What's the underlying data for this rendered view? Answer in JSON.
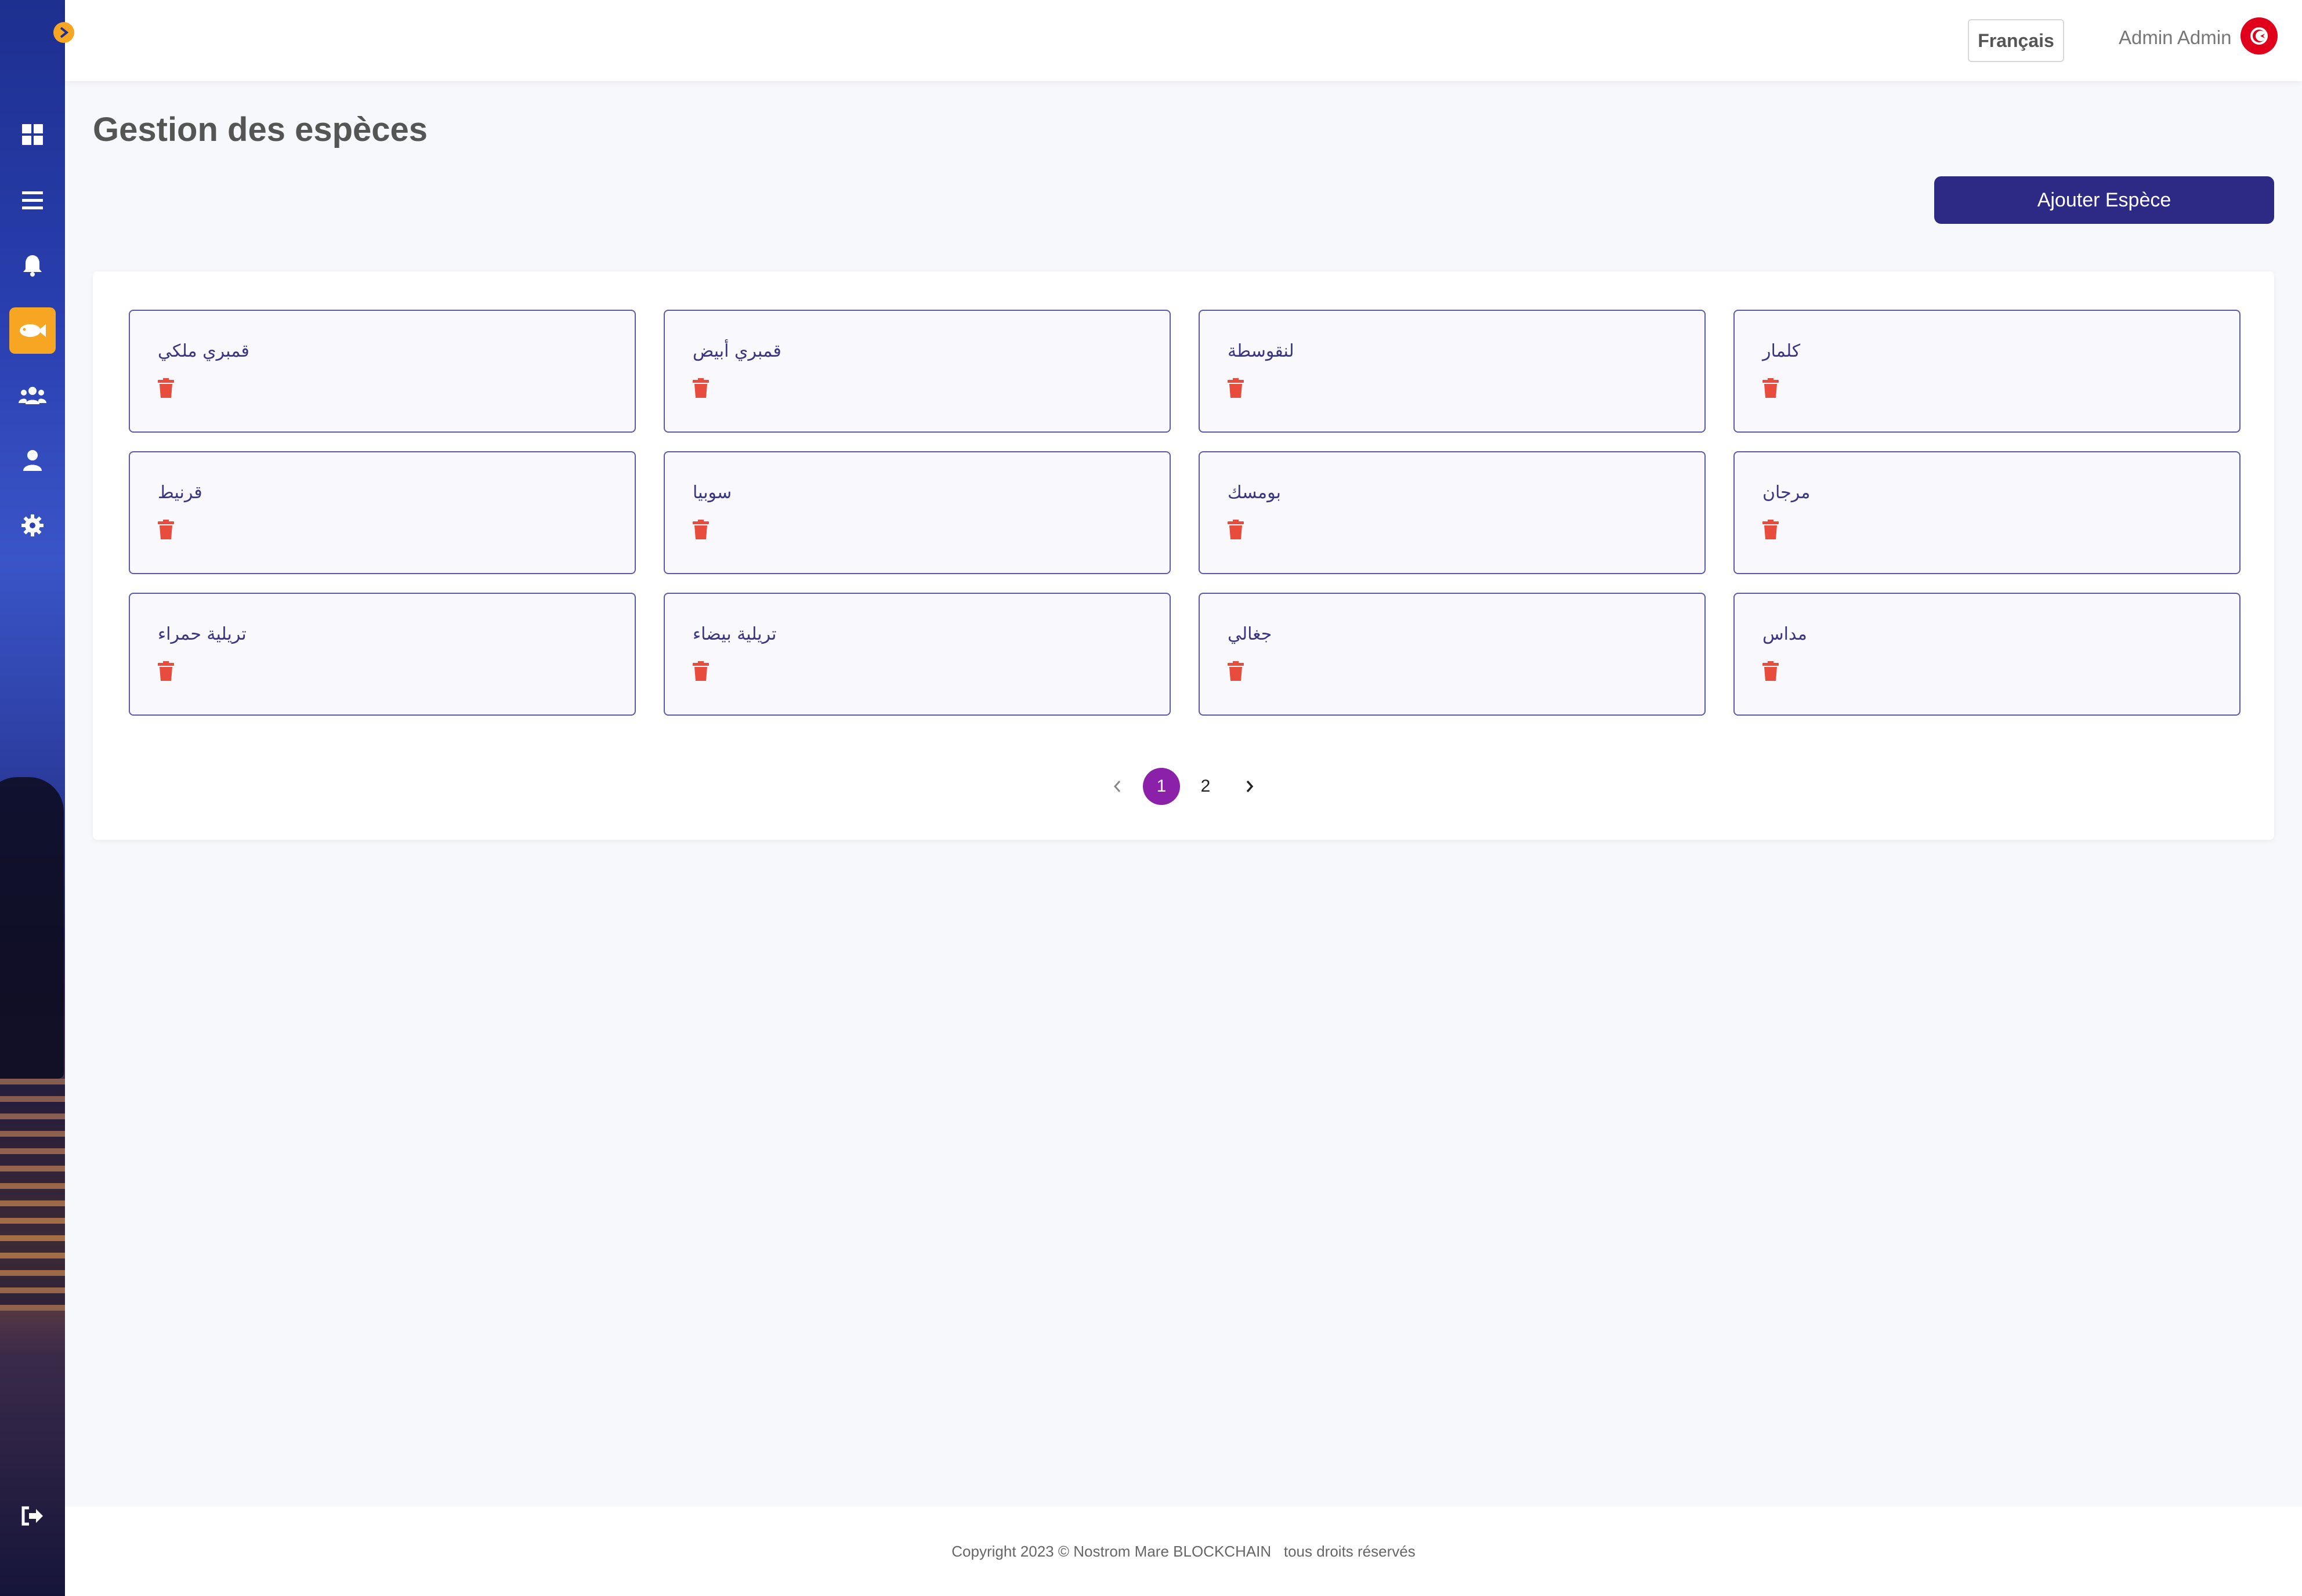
{
  "header": {
    "language": "Français",
    "user_name": "Admin Admin"
  },
  "page": {
    "title": "Gestion des espèces",
    "add_button": "Ajouter Espèce"
  },
  "species": [
    {
      "name": "قمبري ملكي"
    },
    {
      "name": "قمبري أبيض"
    },
    {
      "name": "لنقوسطة"
    },
    {
      "name": "كلمار"
    },
    {
      "name": "قرنيط"
    },
    {
      "name": "سوبيا"
    },
    {
      "name": "بومسك"
    },
    {
      "name": "مرجان"
    },
    {
      "name": "تريلية حمراء"
    },
    {
      "name": "تريلية بيضاء"
    },
    {
      "name": "جغالي"
    },
    {
      "name": "مداس"
    }
  ],
  "pagination": {
    "pages": [
      "1",
      "2"
    ],
    "current": "1"
  },
  "footer": {
    "text": "Copyright 2023 © Nostrom Mare BLOCKCHAIN   tous droits réservés"
  },
  "colors": {
    "accent": "#f6a623",
    "primary": "#2c2a85",
    "page_active": "#8b21a8",
    "danger": "#e74c3c"
  },
  "icons": {
    "sidebar": [
      "dashboard-icon",
      "menu-icon",
      "bell-icon",
      "fish-icon",
      "users-icon",
      "user-icon",
      "gear-icon"
    ],
    "logout": "logout-icon"
  }
}
